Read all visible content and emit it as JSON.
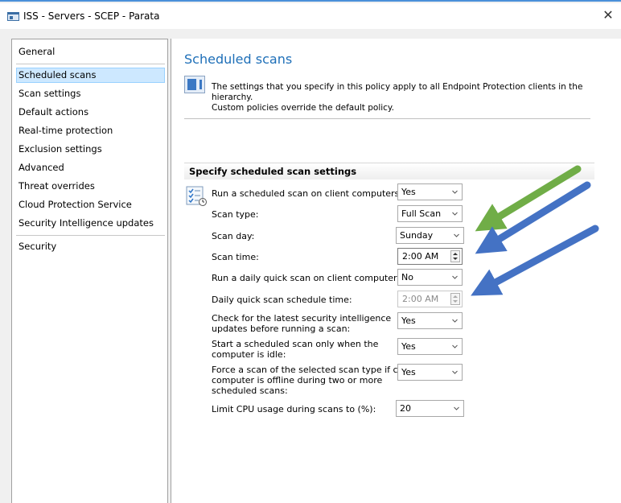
{
  "window": {
    "title": "ISS - Servers - SCEP - Parata",
    "close_symbol": "✕"
  },
  "nav": {
    "items": [
      {
        "label": "General"
      },
      {
        "label": "Scheduled scans"
      },
      {
        "label": "Scan settings"
      },
      {
        "label": "Default actions"
      },
      {
        "label": "Real-time protection"
      },
      {
        "label": "Exclusion settings"
      },
      {
        "label": "Advanced"
      },
      {
        "label": "Threat overrides"
      },
      {
        "label": "Cloud Protection Service"
      },
      {
        "label": "Security Intelligence updates"
      },
      {
        "label": "Security"
      }
    ],
    "selected": "Scheduled scans"
  },
  "page": {
    "title": "Scheduled scans",
    "info_line1": "The settings that you specify in this policy apply to all Endpoint Protection clients in the hierarchy.",
    "info_line2": "Custom policies override the default policy.",
    "section_header": "Specify scheduled scan settings"
  },
  "settings": [
    {
      "label": "Run a scheduled scan on client computers:",
      "value": "Yes",
      "control": "dropdown"
    },
    {
      "label": "Scan type:",
      "value": "Full Scan",
      "control": "dropdown"
    },
    {
      "label": "Scan day:",
      "value": "Sunday",
      "control": "dropdown"
    },
    {
      "label": "Scan time:",
      "value": "2:00 AM",
      "control": "spinner"
    },
    {
      "label": "Run a daily quick scan on client computers:",
      "value": "No",
      "control": "dropdown"
    },
    {
      "label": "Daily quick scan schedule time:",
      "value": "2:00 AM",
      "control": "spinner",
      "disabled": true
    },
    {
      "label_line1": "Check for the latest security intelligence",
      "label_line2": "updates before running a scan:",
      "value": "Yes",
      "control": "dropdown"
    },
    {
      "label_line1": "Start a scheduled scan only when the",
      "label_line2": "computer is idle:",
      "value": "Yes",
      "control": "dropdown"
    },
    {
      "label_line1": "Force a scan of the selected scan type if client",
      "label_line2": "computer is offline during two or more",
      "label_line3": "scheduled scans:",
      "value": "Yes",
      "control": "dropdown"
    },
    {
      "label": "Limit CPU usage during scans to (%):",
      "value": "20",
      "control": "dropdown"
    }
  ],
  "annotations": {
    "arrow_colors": [
      "#70ad47",
      "#4472c4",
      "#4472c4",
      "#4472c4"
    ]
  }
}
